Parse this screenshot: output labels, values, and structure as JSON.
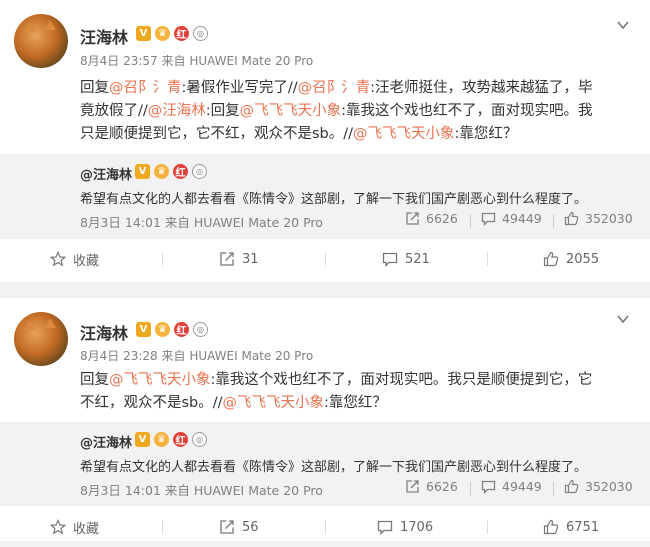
{
  "posts": [
    {
      "author": "汪海林",
      "time": "8月4日 23:57",
      "source": "来自 HUAWEI Mate 20 Pro",
      "text_lines": [
        [
          {
            "t": "回复",
            "c": false
          },
          {
            "t": "@召阝氵青",
            "c": true
          },
          {
            "t": ":暑假作业写完了//",
            "c": false
          },
          {
            "t": "@召阝氵青",
            "c": true
          },
          {
            "t": ":汪老师挺住，攻势越来越猛了，毕",
            "c": false
          }
        ],
        [
          {
            "t": "竟放假了//",
            "c": false
          },
          {
            "t": "@汪海林",
            "c": true
          },
          {
            "t": ":回复",
            "c": false
          },
          {
            "t": "@飞飞飞天小象",
            "c": true
          },
          {
            "t": ":靠我这个戏也红不了，面对现实吧。我",
            "c": false
          }
        ],
        [
          {
            "t": "只是顺便提到它，它不红，观众不是sb。//",
            "c": false
          },
          {
            "t": "@飞飞飞天小象",
            "c": true
          },
          {
            "t": ":靠您红？",
            "c": false
          }
        ]
      ],
      "repost": {
        "author": "@汪海林",
        "text": "希望有点文化的人都去看看《陈情令》这部剧，了解一下我们国产剧恶心到什么程度了。",
        "time": "8月3日 14:01",
        "source": "来自 HUAWEI Mate 20 Pro",
        "reposts": "6626",
        "comments": "49449",
        "likes": "352030"
      },
      "actions": {
        "favorite": "收藏",
        "reposts": "31",
        "comments": "521",
        "likes": "2055"
      }
    },
    {
      "author": "汪海林",
      "time": "8月4日 23:28",
      "source": "来自 HUAWEI Mate 20 Pro",
      "text_lines": [
        [
          {
            "t": "回复",
            "c": false
          },
          {
            "t": "@飞飞飞天小象",
            "c": true
          },
          {
            "t": ":靠我这个戏也红不了，面对现实吧。我只是顺便提到它，它",
            "c": false
          }
        ],
        [
          {
            "t": "不红，观众不是sb。//",
            "c": false
          },
          {
            "t": "@飞飞飞天小象",
            "c": true
          },
          {
            "t": ":靠您红？",
            "c": false
          }
        ]
      ],
      "repost": {
        "author": "@汪海林",
        "text": "希望有点文化的人都去看看《陈情令》这部剧，了解一下我们国产剧恶心到什么程度了。",
        "time": "8月3日 14:01",
        "source": "来自 HUAWEI Mate 20 Pro",
        "reposts": "6626",
        "comments": "49449",
        "likes": "352030"
      },
      "actions": {
        "favorite": "收藏",
        "reposts": "56",
        "comments": "1706",
        "likes": "6751"
      }
    }
  ],
  "badges": {
    "v": "V",
    "red": "红",
    "medal": "◎"
  },
  "colors": {
    "link": "#eb7350",
    "gray": "#808080",
    "bg": "#f2f2f5"
  },
  "icons": [
    "chevron-down-icon",
    "star-icon",
    "repost-icon",
    "comment-icon",
    "like-icon"
  ]
}
